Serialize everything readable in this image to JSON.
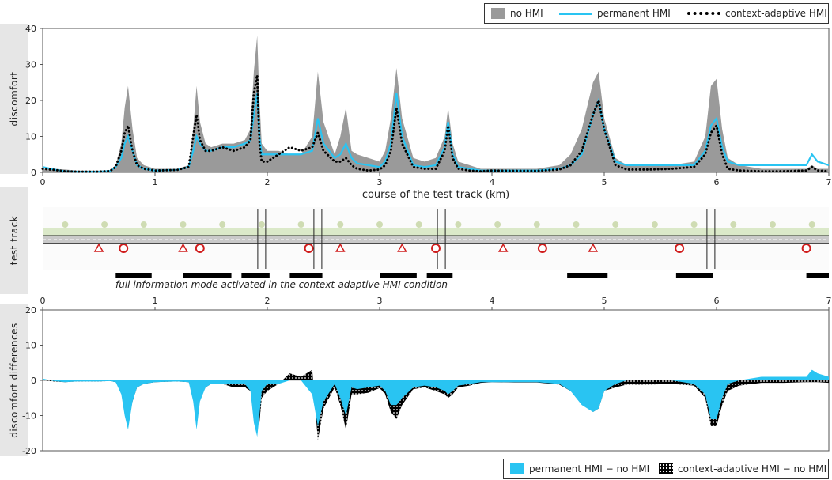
{
  "legend_top": {
    "items": [
      {
        "label": "no HMI",
        "color": "#9a9a9a"
      },
      {
        "label": "permanent HMI",
        "color": "#29c4f2"
      },
      {
        "label": "context-adaptive HMI",
        "color": "#000000"
      }
    ]
  },
  "legend_bottom": {
    "items": [
      {
        "label": "permanent HMI − no HMI",
        "color": "#29c4f2"
      },
      {
        "label": "context-adaptive HMI − no HMI",
        "color": "#000000"
      }
    ]
  },
  "side_labels": {
    "top": "discomfort",
    "middle": "test track",
    "bottom": "discomfort differences"
  },
  "annotation": "full information mode activated in the context-adaptive HMI condition",
  "full_info_segments_km": [
    [
      0.65,
      0.97
    ],
    [
      1.25,
      1.68
    ],
    [
      1.77,
      2.02
    ],
    [
      2.2,
      2.49
    ],
    [
      3.0,
      3.33
    ],
    [
      3.42,
      3.65
    ],
    [
      4.67,
      5.03
    ],
    [
      5.64,
      5.97
    ],
    [
      6.8,
      7.0
    ]
  ],
  "chart_data": [
    {
      "type": "area",
      "title": "",
      "xlabel": "course of the test track (km)",
      "ylabel": "discomfort",
      "xlim": [
        0,
        7
      ],
      "ylim": [
        0,
        40
      ],
      "xticks": [
        0,
        1,
        2,
        3,
        4,
        5,
        6,
        7
      ],
      "yticks": [
        0,
        10,
        20,
        30,
        40
      ],
      "grid": false,
      "legend_position": "top-right",
      "x": [
        0,
        0.1,
        0.2,
        0.3,
        0.4,
        0.5,
        0.6,
        0.65,
        0.7,
        0.73,
        0.76,
        0.8,
        0.84,
        0.9,
        1.0,
        1.1,
        1.2,
        1.3,
        1.34,
        1.37,
        1.4,
        1.45,
        1.5,
        1.6,
        1.7,
        1.8,
        1.85,
        1.88,
        1.91,
        1.93,
        1.95,
        2.0,
        2.1,
        2.2,
        2.3,
        2.4,
        2.45,
        2.5,
        2.6,
        2.65,
        2.7,
        2.75,
        2.8,
        2.9,
        3.0,
        3.05,
        3.1,
        3.15,
        3.2,
        3.3,
        3.4,
        3.5,
        3.58,
        3.61,
        3.65,
        3.7,
        3.8,
        3.9,
        4.0,
        4.2,
        4.4,
        4.6,
        4.7,
        4.8,
        4.9,
        4.95,
        5.0,
        5.1,
        5.2,
        5.4,
        5.6,
        5.8,
        5.9,
        5.95,
        6.0,
        6.05,
        6.1,
        6.2,
        6.4,
        6.6,
        6.8,
        6.85,
        6.9,
        7.0
      ],
      "series": [
        {
          "name": "no HMI",
          "values": [
            1,
            1,
            0.8,
            0.5,
            0.5,
            0.5,
            0.6,
            2,
            8,
            18,
            24,
            12,
            4,
            2,
            1,
            1,
            1,
            2,
            12,
            24,
            14,
            8,
            7,
            8,
            8,
            9,
            12,
            28,
            38,
            20,
            8,
            6,
            6,
            5,
            5,
            10,
            28,
            14,
            5,
            10,
            18,
            6,
            5,
            4,
            3,
            6,
            15,
            29,
            15,
            4,
            3,
            4,
            10,
            18,
            8,
            3,
            2,
            1,
            1,
            1,
            1,
            2,
            5,
            12,
            25,
            28,
            15,
            4,
            2,
            2,
            2,
            3,
            10,
            24,
            26,
            12,
            4,
            2,
            1,
            1,
            1,
            2,
            1,
            1
          ]
        },
        {
          "name": "permanent HMI",
          "values": [
            1.5,
            0.8,
            0.3,
            0.2,
            0.2,
            0.2,
            0.4,
            1.5,
            4,
            8,
            10,
            6,
            2,
            1,
            0.5,
            0.6,
            0.7,
            1.5,
            6,
            10,
            8,
            6,
            6,
            7,
            7,
            8,
            9,
            16,
            22,
            10,
            5,
            5,
            5,
            5,
            5,
            6,
            15,
            8,
            4,
            5,
            8,
            4,
            2.5,
            2,
            1.5,
            3,
            8,
            22,
            10,
            2,
            1.5,
            2,
            7,
            14,
            5,
            1.5,
            1,
            0.5,
            0.5,
            0.5,
            0.5,
            1,
            2,
            5,
            16,
            20,
            12,
            3,
            2,
            2,
            2,
            2,
            6,
            13,
            15,
            7,
            3,
            2,
            2,
            2,
            2,
            5,
            3,
            2
          ]
        },
        {
          "name": "context-adaptive HMI",
          "values": [
            1,
            0.7,
            0.3,
            0.2,
            0.2,
            0.2,
            0.4,
            1.5,
            6,
            11,
            13,
            6,
            2,
            1,
            0.5,
            0.6,
            0.7,
            1.5,
            10,
            16,
            9,
            6,
            6,
            7,
            6,
            7,
            9,
            22,
            27,
            8,
            3,
            3,
            5,
            7,
            6,
            7,
            11,
            6,
            3,
            3,
            4,
            2,
            1,
            0.5,
            0.8,
            2,
            6,
            18,
            8,
            1.5,
            1,
            1,
            6,
            13,
            4,
            1,
            0.5,
            0.3,
            0.5,
            0.4,
            0.4,
            0.8,
            2,
            6,
            16,
            20,
            12,
            2,
            0.8,
            0.8,
            1,
            1.5,
            5,
            11,
            13,
            5,
            1,
            0.5,
            0.3,
            0.3,
            0.5,
            1.5,
            0.5,
            0.3
          ]
        }
      ]
    },
    {
      "type": "area",
      "title": "",
      "xlabel": "",
      "ylabel": "discomfort differences",
      "xlim": [
        0,
        7
      ],
      "ylim": [
        -20,
        20
      ],
      "xticks": [
        0,
        1,
        2,
        3,
        4,
        5,
        6,
        7
      ],
      "yticks": [
        -20,
        -10,
        0,
        10,
        20
      ],
      "grid": false,
      "legend_position": "bottom-right",
      "x": [
        0,
        0.1,
        0.2,
        0.3,
        0.4,
        0.5,
        0.6,
        0.65,
        0.7,
        0.73,
        0.76,
        0.8,
        0.84,
        0.9,
        1.0,
        1.1,
        1.2,
        1.3,
        1.34,
        1.37,
        1.4,
        1.45,
        1.5,
        1.6,
        1.7,
        1.8,
        1.85,
        1.88,
        1.91,
        1.93,
        1.95,
        2.0,
        2.1,
        2.2,
        2.3,
        2.4,
        2.45,
        2.5,
        2.6,
        2.65,
        2.7,
        2.75,
        2.8,
        2.9,
        3.0,
        3.05,
        3.1,
        3.15,
        3.2,
        3.3,
        3.4,
        3.5,
        3.58,
        3.61,
        3.65,
        3.7,
        3.8,
        3.9,
        4.0,
        4.2,
        4.4,
        4.6,
        4.7,
        4.8,
        4.9,
        4.95,
        5.0,
        5.1,
        5.2,
        5.4,
        5.6,
        5.8,
        5.9,
        5.95,
        6.0,
        6.05,
        6.1,
        6.2,
        6.4,
        6.6,
        6.8,
        6.85,
        6.9,
        7.0
      ],
      "series": [
        {
          "name": "permanent HMI − no HMI",
          "values": [
            0.5,
            -0.2,
            -0.5,
            -0.3,
            -0.3,
            -0.3,
            -0.2,
            -0.5,
            -4,
            -10,
            -14,
            -6,
            -2,
            -1,
            -0.5,
            -0.4,
            -0.3,
            -0.5,
            -6,
            -14,
            -6,
            -2,
            -1,
            -1,
            -1,
            -1,
            -3,
            -12,
            -16,
            -10,
            -3,
            -1,
            -1,
            0,
            0,
            -4,
            -13,
            -6,
            -1,
            -5,
            -10,
            -2,
            -2.5,
            -2,
            -1.5,
            -3,
            -7,
            -7,
            -5,
            -2,
            -1.5,
            -2,
            -3,
            -4,
            -3,
            -1.5,
            -1,
            -0.5,
            -0.5,
            -0.5,
            -0.5,
            -1,
            -3,
            -7,
            -9,
            -8,
            -3,
            -1,
            0,
            0,
            0,
            -1,
            -4,
            -11,
            -11,
            -5,
            -1,
            0,
            1,
            1,
            1,
            3,
            2,
            1
          ]
        },
        {
          "name": "context-adaptive HMI − no HMI",
          "values": [
            0,
            -0.3,
            -0.5,
            -0.3,
            -0.3,
            -0.3,
            -0.2,
            -0.5,
            -2,
            -7,
            -11,
            -6,
            -2,
            -1,
            -0.5,
            -0.4,
            -0.3,
            -0.5,
            -2,
            -8,
            -5,
            -2,
            -1,
            -1,
            -2,
            -2,
            -3,
            -6,
            -11,
            -12,
            -5,
            -3,
            -1,
            2,
            1,
            3,
            -17,
            -8,
            -2,
            -7,
            -14,
            -4,
            -4,
            -3.5,
            -2.2,
            -4,
            -9,
            -11,
            -7,
            -2.5,
            -2,
            -3,
            -4,
            -5,
            -4,
            -2,
            -1.5,
            -0.7,
            -0.5,
            -0.6,
            -0.6,
            -1.2,
            -3,
            -6,
            -9,
            -8,
            -3,
            -2,
            -1.2,
            -1.2,
            -1,
            -1.5,
            -5,
            -13,
            -13,
            -7,
            -3,
            -1.5,
            -0.7,
            -0.7,
            -0.5,
            -0.5,
            -0.5,
            -0.7
          ]
        }
      ]
    }
  ]
}
